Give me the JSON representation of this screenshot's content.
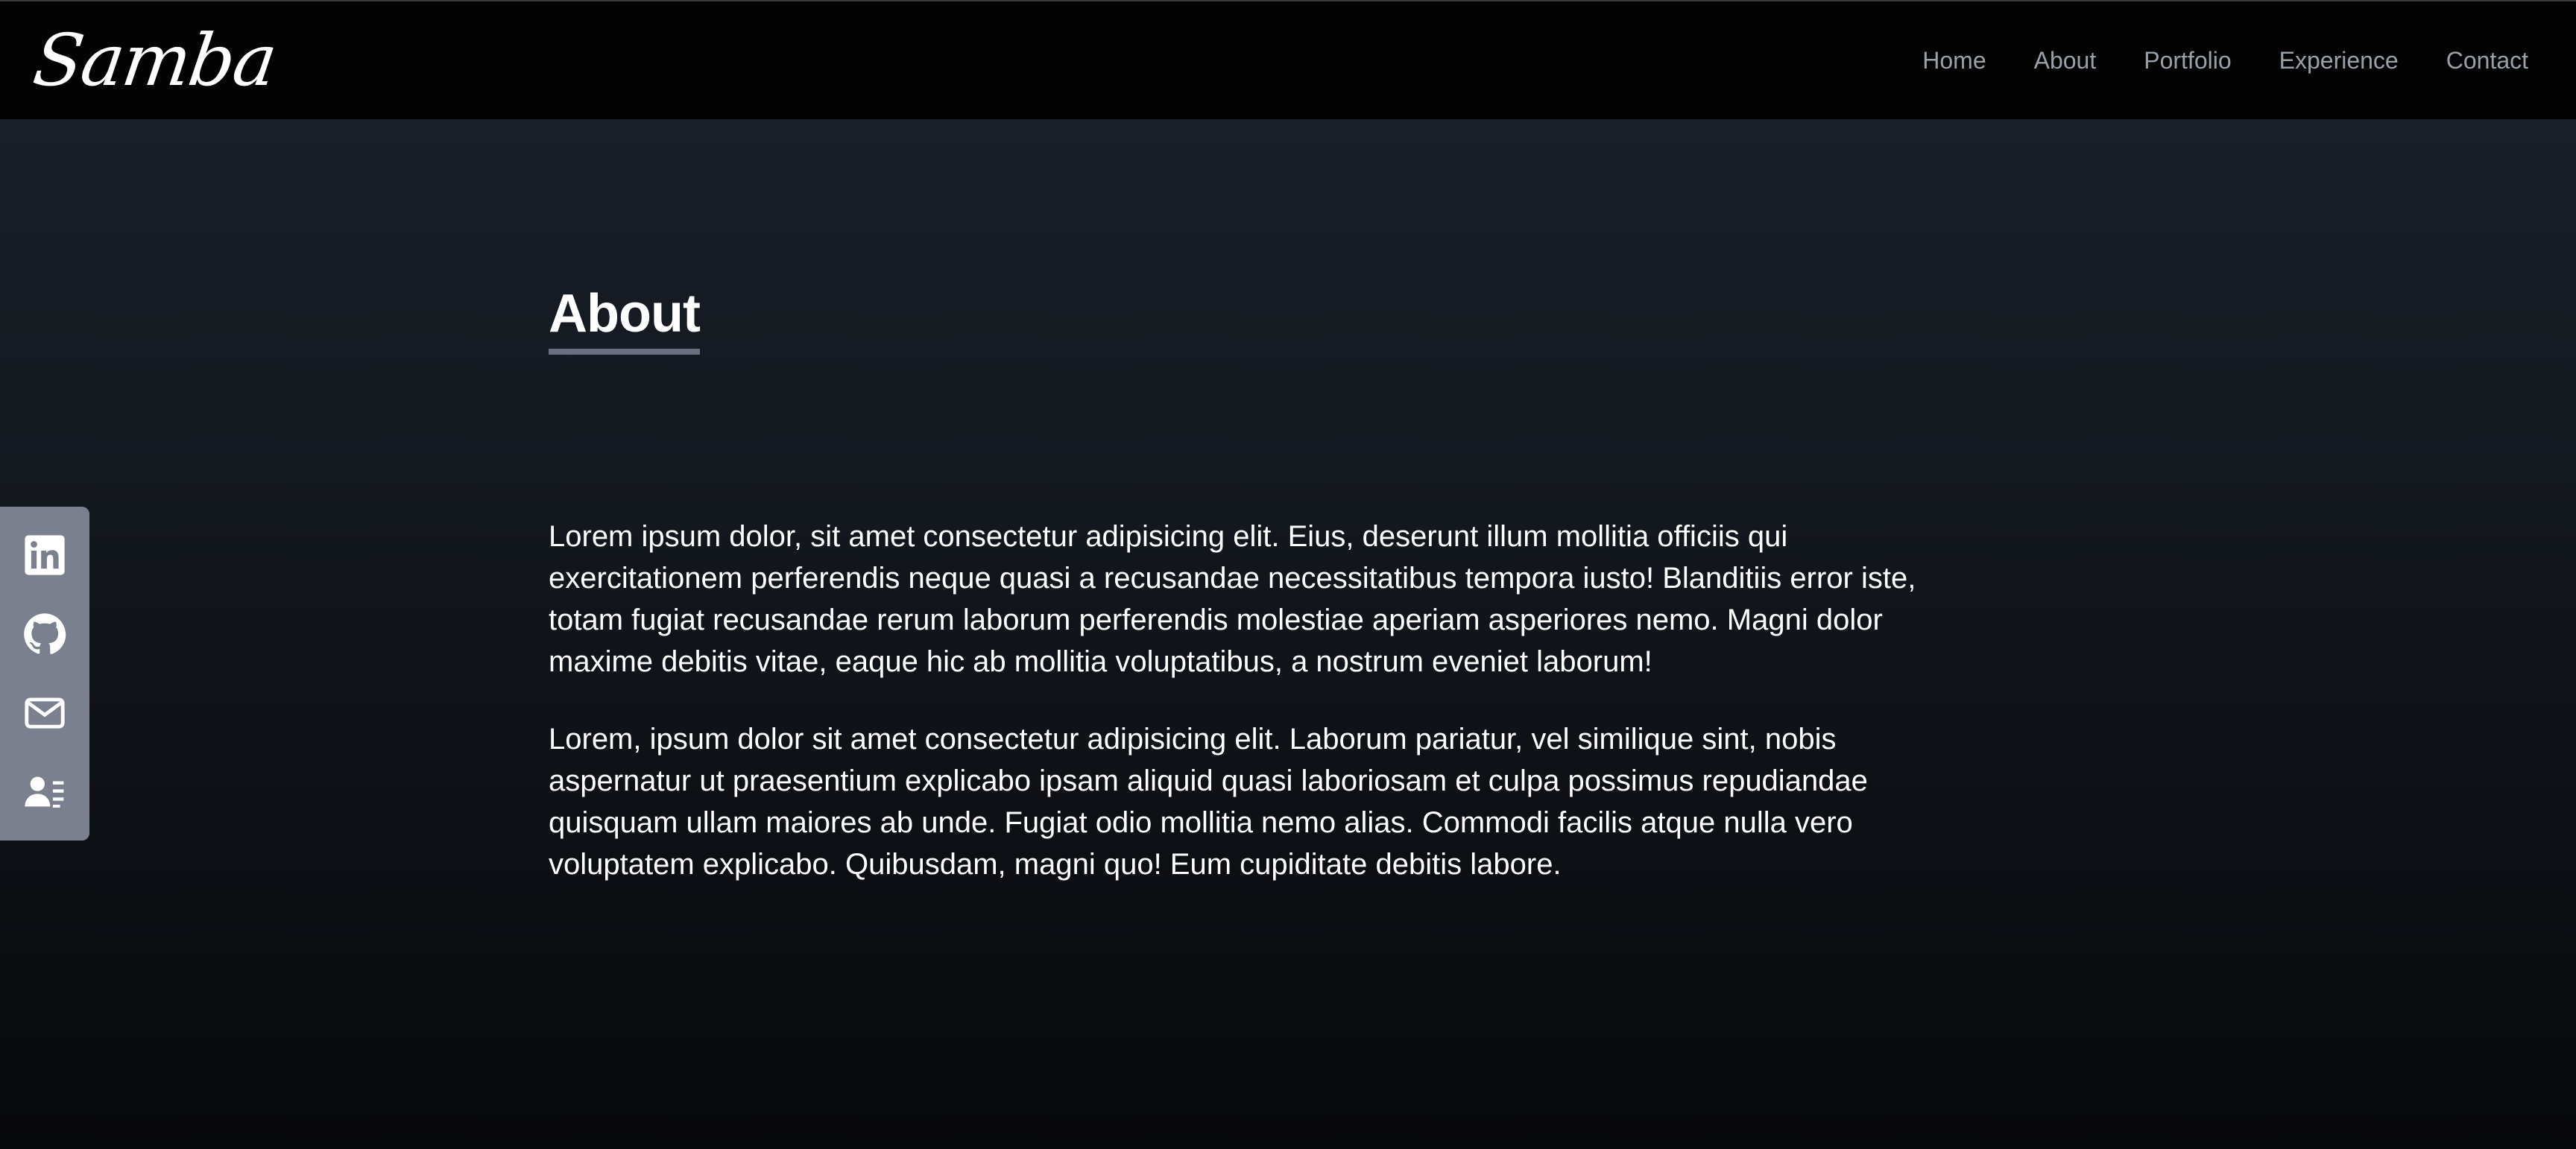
{
  "brand": {
    "logo_text": "Samba"
  },
  "nav": {
    "items": [
      {
        "label": "Home"
      },
      {
        "label": "About"
      },
      {
        "label": "Portfolio"
      },
      {
        "label": "Experience"
      },
      {
        "label": "Contact"
      }
    ]
  },
  "about": {
    "title": "About",
    "paragraphs": [
      "Lorem ipsum dolor, sit amet consectetur adipisicing elit. Eius, deserunt illum mollitia officiis qui exercitationem perferendis neque quasi a recusandae necessitatibus tempora iusto! Blanditiis error iste, totam fugiat recusandae rerum laborum perferendis molestiae aperiam asperiores nemo. Magni dolor maxime debitis vitae, eaque hic ab mollitia voluptatibus, a nostrum eveniet laborum!",
      "Lorem, ipsum dolor sit amet consectetur adipisicing elit. Laborum pariatur, vel similique sint, nobis aspernatur ut praesentium explicabo ipsam aliquid quasi laboriosam et culpa possimus repudiandae quisquam ullam maiores ab unde. Fugiat odio mollitia nemo alias. Commodi facilis atque nulla vero voluptatem explicabo. Quibusdam, magni quo! Eum cupiditate debitis labore."
    ]
  },
  "social": {
    "icons": [
      "linkedin-icon",
      "github-icon",
      "mail-icon",
      "resume-icon"
    ]
  },
  "colors": {
    "navbar_bg": "#030303",
    "nav_link": "#9aa0a8",
    "social_bar_bg": "#7b808e",
    "title_underline": "#6b7080"
  }
}
